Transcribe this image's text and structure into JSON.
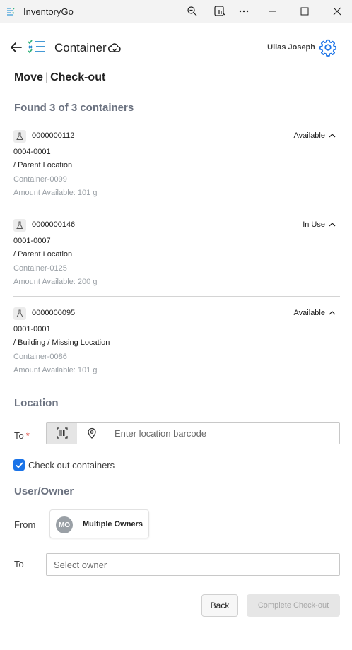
{
  "window": {
    "app_name": "InventoryGo",
    "controls": [
      "zoom-icon",
      "screenshot-icon",
      "more-icon",
      "minimize-icon",
      "maximize-icon",
      "close-icon"
    ]
  },
  "header": {
    "title": "Container",
    "user_name": "Ullas Joseph"
  },
  "heading": {
    "move": "Move",
    "separator": "|",
    "checkout": "Check-out"
  },
  "found_text": "Found 3 of 3 containers",
  "containers": [
    {
      "id": "0000000112",
      "status": "Available",
      "code": "0004-0001",
      "location": "/ Parent Location",
      "container": "Container-0099",
      "amount": "Amount Available: 101 g"
    },
    {
      "id": "0000000146",
      "status": "In Use",
      "code": "0001-0007",
      "location": "/ Parent Location",
      "container": "Container-0125",
      "amount": "Amount Available: 200 g"
    },
    {
      "id": "0000000095",
      "status": "Available",
      "code": "0001-0001",
      "location": "/ Building / Missing Location",
      "container": "Container-0086",
      "amount": "Amount Available: 101 g"
    }
  ],
  "location": {
    "title": "Location",
    "to_label": "To",
    "required_mark": "*",
    "placeholder": "Enter location barcode",
    "value": ""
  },
  "checkout_option": {
    "label": "Check out containers",
    "checked": true
  },
  "owner": {
    "title": "User/Owner",
    "from_label": "From",
    "from_initials": "MO",
    "from_value": "Multiple Owners",
    "to_label": "To",
    "to_placeholder": "Select owner",
    "to_value": ""
  },
  "actions": {
    "back": "Back",
    "complete": "Complete Check-out"
  },
  "colors": {
    "accent": "#1a73e8",
    "muted_text": "#9aa0a6",
    "section_text": "#6b7280",
    "required": "#d92d20"
  }
}
